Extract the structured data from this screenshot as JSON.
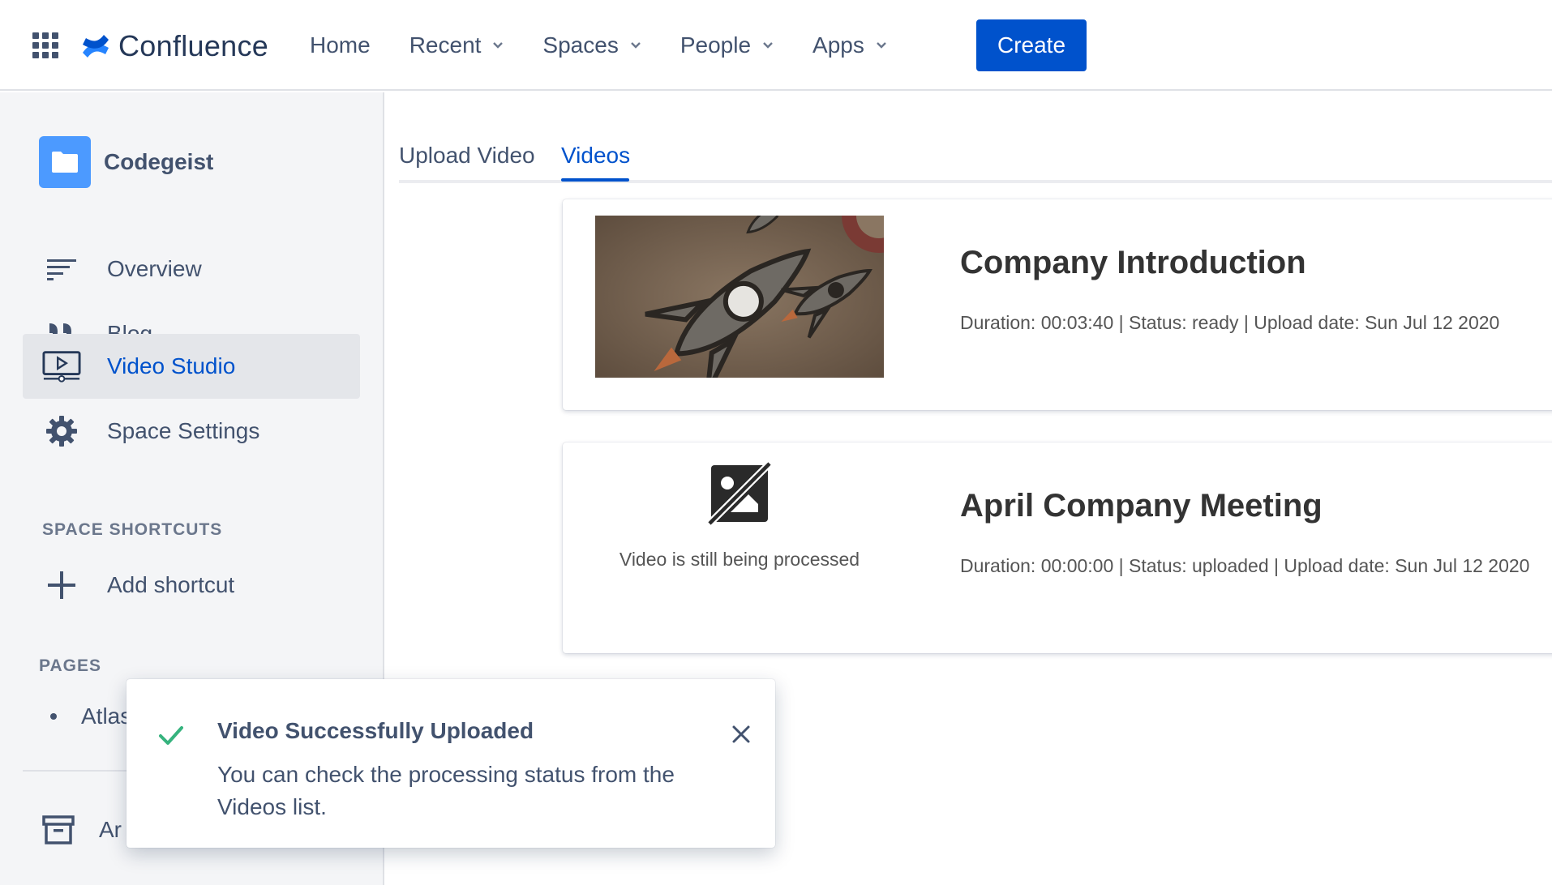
{
  "topnav": {
    "brand": "Confluence",
    "items": [
      {
        "label": "Home",
        "dropdown": false
      },
      {
        "label": "Recent",
        "dropdown": true
      },
      {
        "label": "Spaces",
        "dropdown": true
      },
      {
        "label": "People",
        "dropdown": true
      },
      {
        "label": "Apps",
        "dropdown": true
      }
    ],
    "create_label": "Create"
  },
  "sidebar": {
    "space_name": "Codegeist",
    "items": [
      {
        "label": "Overview",
        "icon": "overview-icon",
        "active": false
      },
      {
        "label": "Blog",
        "icon": "quote-icon",
        "active": false
      },
      {
        "label": "Video Studio",
        "icon": "video-studio-icon",
        "active": true
      },
      {
        "label": "Space Settings",
        "icon": "gear-icon",
        "active": false
      }
    ],
    "shortcuts_title": "SPACE SHORTCUTS",
    "add_shortcut": "Add shortcut",
    "pages_title": "PAGES",
    "page_item": "Atlas",
    "archive_label": "Ar"
  },
  "tabs": [
    {
      "label": "Upload Video",
      "active": false
    },
    {
      "label": "Videos",
      "active": true
    }
  ],
  "videos": [
    {
      "title": "Company Introduction",
      "meta": "Duration: 00:03:40 | Status: ready | Upload date: Sun Jul 12 2020",
      "has_thumbnail": true
    },
    {
      "title": "April Company Meeting",
      "meta": "Duration: 00:00:00 | Status: uploaded | Upload date: Sun Jul 12 2020",
      "has_thumbnail": false,
      "placeholder_text": "Video is still being processed"
    }
  ],
  "flag": {
    "title": "Video Successfully Uploaded",
    "body": "You can check the processing status from the Videos list."
  },
  "colors": {
    "brand_blue": "#0052CC",
    "success_green": "#36B37E",
    "sidebar_bg": "#F4F5F7"
  }
}
